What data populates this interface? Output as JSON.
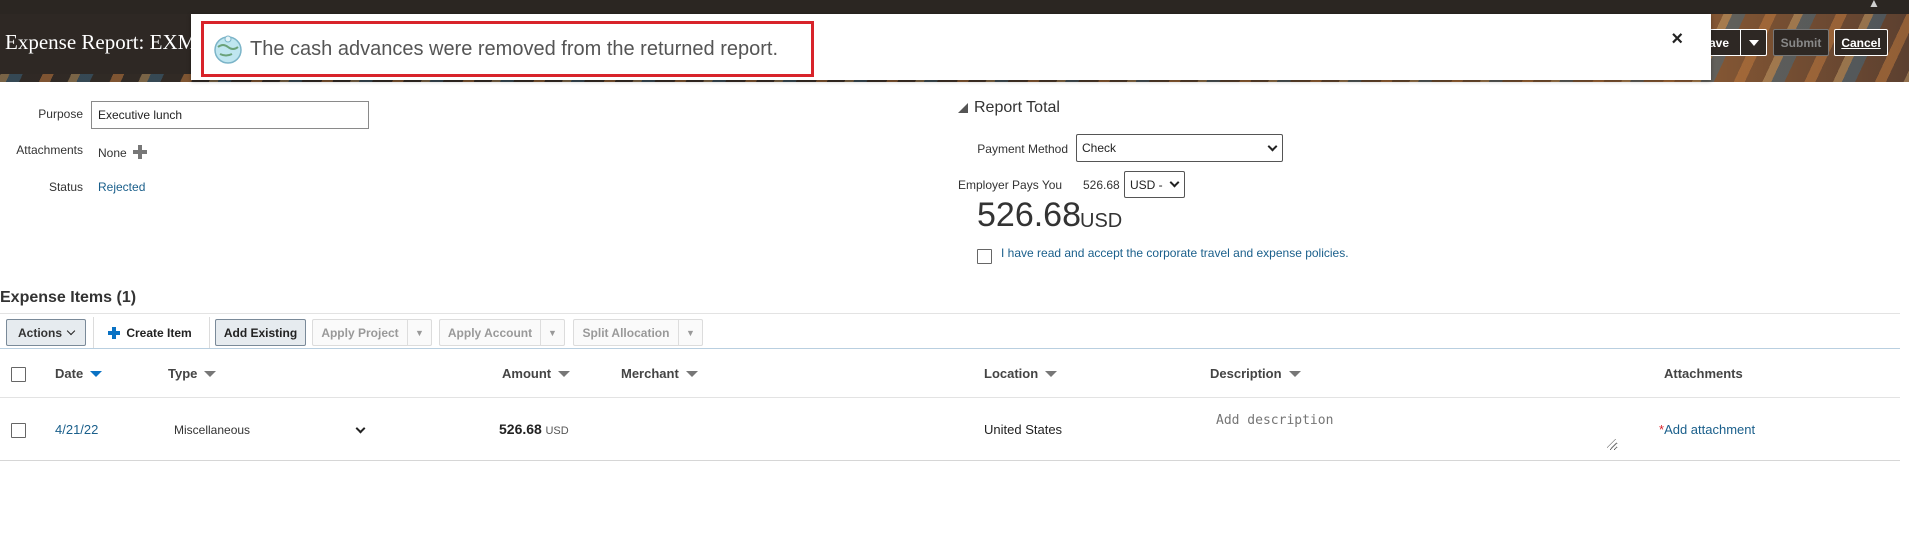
{
  "header": {
    "page_title": "Expense Report: EXM",
    "save_label": "ave",
    "submit_label": "Submit",
    "cancel_label": "Cancel"
  },
  "toast": {
    "message": "The cash advances were removed from the returned report.",
    "close_symbol": "×"
  },
  "form": {
    "purpose_label": "Purpose",
    "purpose_value": "Executive lunch",
    "attachments_label": "Attachments",
    "attachments_value": "None",
    "status_label": "Status",
    "status_value": "Rejected"
  },
  "report_total": {
    "section_title": "Report Total",
    "payment_method_label": "Payment Method",
    "payment_method_value": "Check",
    "employer_pays_label": "Employer Pays You",
    "employer_pays_amount": "526.68",
    "currency_select": "USD -",
    "big_amount": "526.68",
    "big_currency": "USD",
    "policy_text": "I have read and accept the corporate travel and expense policies."
  },
  "expense_items": {
    "heading": "Expense Items (1)",
    "toolbar": {
      "actions": "Actions",
      "create_item": "Create Item",
      "add_existing": "Add Existing",
      "apply_project": "Apply Project",
      "apply_account": "Apply Account",
      "split_allocation": "Split Allocation"
    },
    "columns": {
      "date": "Date",
      "type": "Type",
      "amount": "Amount",
      "merchant": "Merchant",
      "location": "Location",
      "description": "Description",
      "attachments": "Attachments"
    },
    "rows": [
      {
        "date": "4/21/22",
        "type": "Miscellaneous",
        "amount": "526.68",
        "currency": "USD",
        "merchant": "",
        "location": "United States",
        "description_placeholder": "Add description",
        "attachment_required": "*",
        "attachment_link": "Add attachment"
      }
    ]
  },
  "colors": {
    "link": "#1a5f8b",
    "toast_border": "#d8232a",
    "sort_active": "#0a72c4",
    "header_bg": "#2b2622"
  }
}
